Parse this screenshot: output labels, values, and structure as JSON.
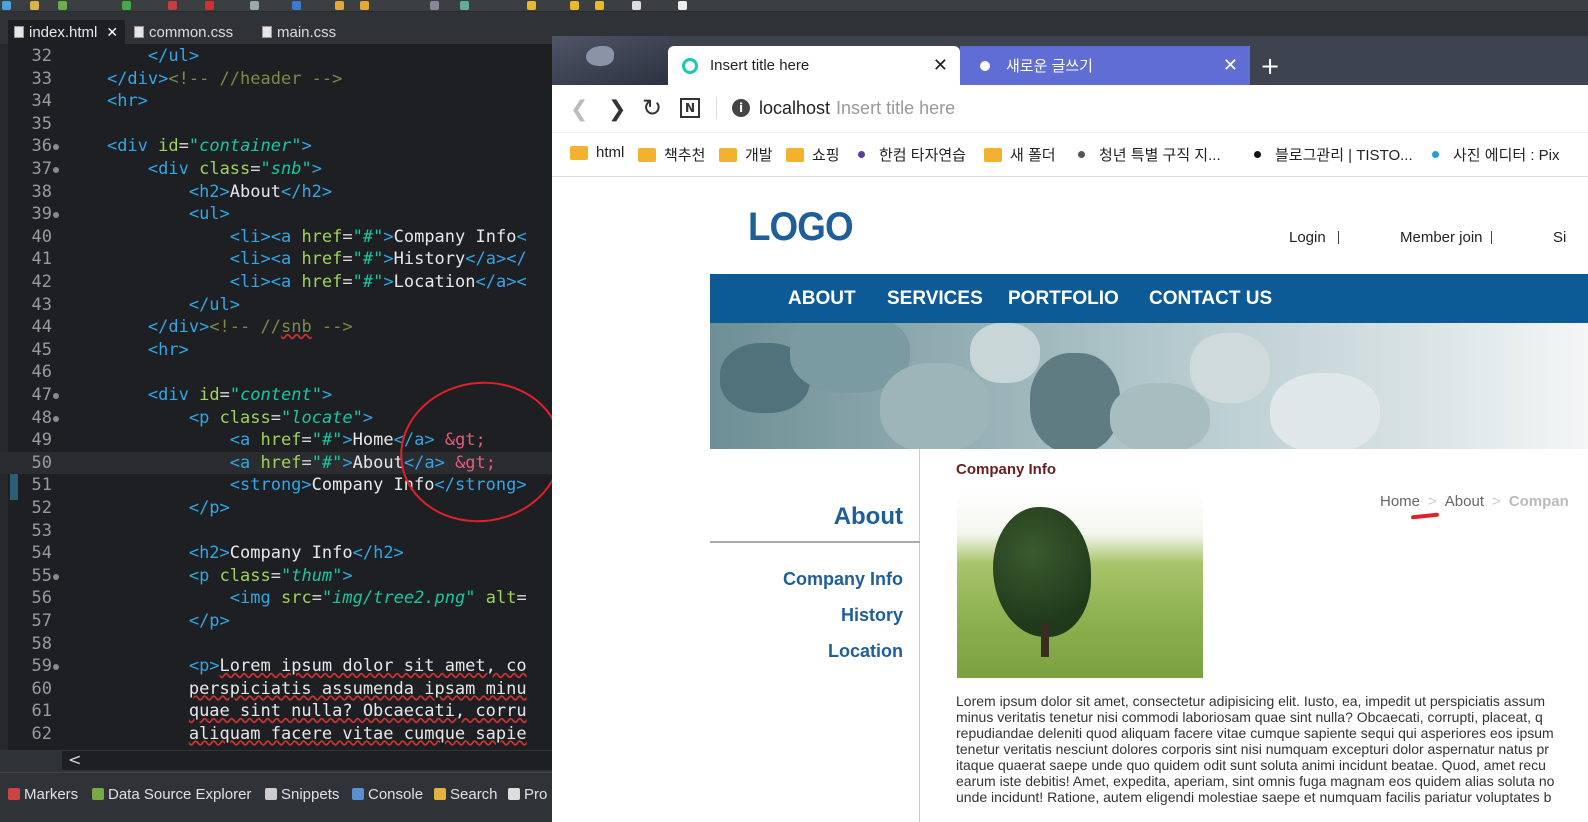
{
  "ide": {
    "tabs": [
      {
        "label": "index.html",
        "active": true
      },
      {
        "label": "common.css",
        "active": false
      },
      {
        "label": "main.css",
        "active": false
      }
    ],
    "views": [
      "Markers",
      "Data Source Explorer",
      "Snippets",
      "Console",
      "Search",
      "Pro"
    ],
    "scroll_left": "<",
    "lines": [
      {
        "n": "32",
        "html": "        <span class='t'>&lt;/ul&gt;</span>"
      },
      {
        "n": "33",
        "html": "    <span class='t'>&lt;/div&gt;</span><span class='cm'>&lt;!-- //header --&gt;</span>"
      },
      {
        "n": "34",
        "html": "    <span class='t'>&lt;hr&gt;</span>"
      },
      {
        "n": "35",
        "html": ""
      },
      {
        "n": "36",
        "fold": true,
        "html": "    <span class='t'>&lt;div</span> <span class='a'>id</span>=<span class='s'>\"container\"</span><span class='t'>&gt;</span>"
      },
      {
        "n": "37",
        "fold": true,
        "html": "        <span class='t'>&lt;div</span> <span class='a'>class</span>=<span class='s'>\"snb\"</span><span class='t'>&gt;</span>"
      },
      {
        "n": "38",
        "html": "            <span class='t'>&lt;h2&gt;</span><span class='tx'>About</span><span class='t'>&lt;/h2&gt;</span>"
      },
      {
        "n": "39",
        "fold": true,
        "html": "            <span class='t'>&lt;ul&gt;</span>"
      },
      {
        "n": "40",
        "html": "                <span class='t'>&lt;li&gt;&lt;a</span> <span class='a'>href</span>=<span class='s'>\"#\"</span><span class='t'>&gt;</span><span class='tx'>Company Info</span><span class='t'>&lt;</span>"
      },
      {
        "n": "41",
        "html": "                <span class='t'>&lt;li&gt;&lt;a</span> <span class='a'>href</span>=<span class='s'>\"#\"</span><span class='t'>&gt;</span><span class='tx'>History</span><span class='t'>&lt;/a&gt;&lt;/</span>"
      },
      {
        "n": "42",
        "html": "                <span class='t'>&lt;li&gt;&lt;a</span> <span class='a'>href</span>=<span class='s'>\"#\"</span><span class='t'>&gt;</span><span class='tx'>Location</span><span class='t'>&lt;/a&gt;&lt;</span>"
      },
      {
        "n": "43",
        "html": "            <span class='t'>&lt;/ul&gt;</span>"
      },
      {
        "n": "44",
        "html": "        <span class='t'>&lt;/div&gt;</span><span class='cm'>&lt;!-- //<span class='sq'>snb</span> --&gt;</span>"
      },
      {
        "n": "45",
        "html": "        <span class='t'>&lt;hr&gt;</span>"
      },
      {
        "n": "46",
        "html": ""
      },
      {
        "n": "47",
        "fold": true,
        "html": "        <span class='t'>&lt;div</span> <span class='a'>id</span>=<span class='s'>\"content\"</span><span class='t'>&gt;</span>"
      },
      {
        "n": "48",
        "fold": true,
        "html": "            <span class='t'>&lt;p</span> <span class='a'>class</span>=<span class='s'>\"locate\"</span><span class='t'>&gt;</span>"
      },
      {
        "n": "49",
        "html": "                <span class='t'>&lt;a</span> <span class='a'>href</span>=<span class='s'>\"#\"</span><span class='t'>&gt;</span><span class='tx'>Home</span><span class='t'>&lt;/a&gt;</span> <span class='e'>&amp;gt;</span>"
      },
      {
        "n": "50",
        "cur": true,
        "html": "                <span class='t'>&lt;a</span> <span class='a'>href</span>=<span class='s'>\"#\"</span><span class='t'>&gt;</span><span class='tx'>About</span><span class='t'>&lt;/a&gt;</span> <span class='e'>&amp;gt;</span>"
      },
      {
        "n": "51",
        "html": "                <span class='t'>&lt;strong&gt;</span><span class='tx'>Company Info</span><span class='t'>&lt;/strong&gt;</span>"
      },
      {
        "n": "52",
        "html": "            <span class='t'>&lt;/p&gt;</span>"
      },
      {
        "n": "53",
        "html": ""
      },
      {
        "n": "54",
        "html": "            <span class='t'>&lt;h2&gt;</span><span class='tx'>Company Info</span><span class='t'>&lt;/h2&gt;</span>"
      },
      {
        "n": "55",
        "fold": true,
        "html": "            <span class='t'>&lt;p</span> <span class='a'>class</span>=<span class='s'>\"thum\"</span><span class='t'>&gt;</span>"
      },
      {
        "n": "56",
        "html": "                <span class='t'>&lt;img</span> <span class='a'>src</span>=<span class='s'>\"img/tree2.png\"</span> <span class='a'>alt</span>="
      },
      {
        "n": "57",
        "html": "            <span class='t'>&lt;/p&gt;</span>"
      },
      {
        "n": "58",
        "html": ""
      },
      {
        "n": "59",
        "fold": true,
        "html": "            <span class='t'>&lt;p&gt;</span><span class='tx sq'>Lorem ipsum dolor sit amet, co</span>"
      },
      {
        "n": "60",
        "html": "            <span class='tx sq'>perspiciatis assumenda ipsam minu</span>"
      },
      {
        "n": "61",
        "html": "            <span class='tx sq'>quae sint nulla? Obcaecati, corru</span>"
      },
      {
        "n": "62",
        "html": "            <span class='tx sq'>aliquam facere vitae cumque sapie</span>"
      }
    ]
  },
  "browser": {
    "tabs": [
      {
        "label": "Insert title here",
        "active": true,
        "icon_color": "#1ec8b0"
      },
      {
        "label": "새로운 글쓰기",
        "active": false,
        "icon_color": "#ffffff"
      }
    ],
    "new_tab": "+",
    "address": {
      "host": "localhost",
      "title": "Insert title here"
    },
    "bookmarks": [
      {
        "label": "html",
        "type": "folder"
      },
      {
        "label": "책추천",
        "type": "folder"
      },
      {
        "label": "개발",
        "type": "folder"
      },
      {
        "label": "쇼핑",
        "type": "folder"
      },
      {
        "label": "한컴 타자연습",
        "type": "dot",
        "color": "#5b3fa0"
      },
      {
        "label": "새 폴더",
        "type": "folder"
      },
      {
        "label": "청년 특별 구직 지...",
        "type": "dot",
        "color": "#555555"
      },
      {
        "label": "블로그관리 | TISTO...",
        "type": "dot",
        "color": "#111111"
      },
      {
        "label": "사진 에디터 : Pix",
        "type": "dot",
        "color": "#1ea0d8"
      }
    ]
  },
  "site": {
    "logo": "LOGO",
    "util": [
      "Login",
      "Member join",
      "Si"
    ],
    "gnb": [
      "ABOUT",
      "SERVICES",
      "PORTFOLIO",
      "CONTACT US"
    ],
    "snb": {
      "title": "About",
      "items": [
        "Company Info",
        "History",
        "Location"
      ]
    },
    "content": {
      "h2": "Company Info",
      "locate": {
        "home": "Home",
        "about": "About",
        "current": "Compan"
      },
      "paragraph_lines": [
        "Lorem ipsum dolor sit amet, consectetur adipisicing elit. Iusto, ea, impedit ut perspiciatis assum",
        "minus veritatis tenetur nisi commodi laboriosam quae sint nulla? Obcaecati, corrupti, placeat, q",
        "repudiandae deleniti quod aliquam facere vitae cumque sapiente sequi qui asperiores eos ipsum",
        "tenetur veritatis nesciunt dolores corporis sint nisi numquam excepturi dolor aspernatur natus pr",
        "itaque quaerat saepe unde quo quidem odit sunt soluta animi incidunt beatae. Quod, amet recu",
        "earum iste debitis! Amet, expedita, aperiam, sint omnis fuga magnam eos quidem alias soluta no",
        "unde incidunt! Ratione, autem eligendi molestiae saepe et numquam facilis pariatur voluptates b"
      ]
    }
  }
}
